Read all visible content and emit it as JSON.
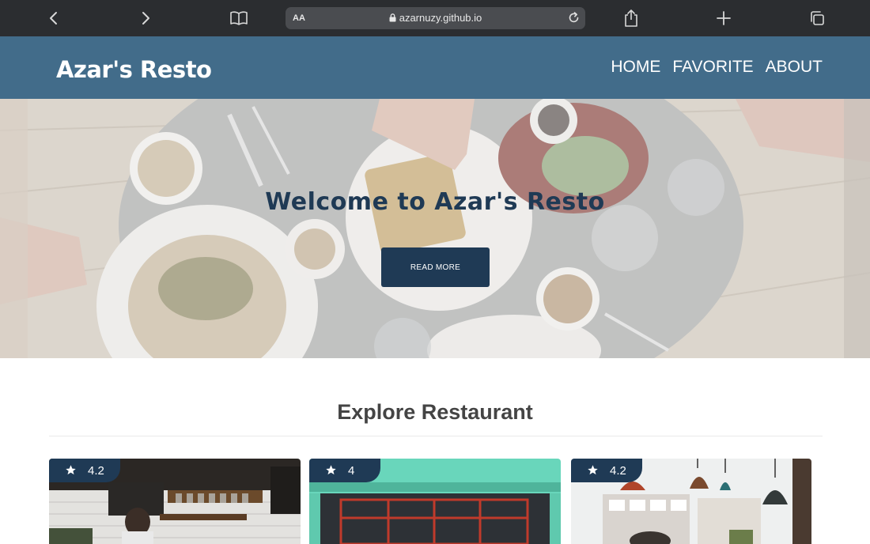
{
  "browser": {
    "url_aa": "AA",
    "url": "azarnuzy.github.io",
    "icons": [
      "back-icon",
      "forward-icon",
      "book-icon",
      "lock-icon",
      "reload-icon",
      "share-icon",
      "plus-icon",
      "tabs-icon"
    ]
  },
  "header": {
    "brand": "Azar's Resto",
    "nav": [
      "HOME",
      "FAVORITE",
      "ABOUT"
    ]
  },
  "hero": {
    "title": "Welcome to Azar's Resto",
    "button_label": "READ MORE"
  },
  "main": {
    "section_title": "Explore Restaurant",
    "restaurants": [
      {
        "rating": "4.2"
      },
      {
        "rating": "4"
      },
      {
        "rating": "4.2"
      }
    ]
  },
  "colors": {
    "header": "#426c8a",
    "accent_dark": "#1f3a55",
    "browser_bar": "#2b2d30"
  }
}
